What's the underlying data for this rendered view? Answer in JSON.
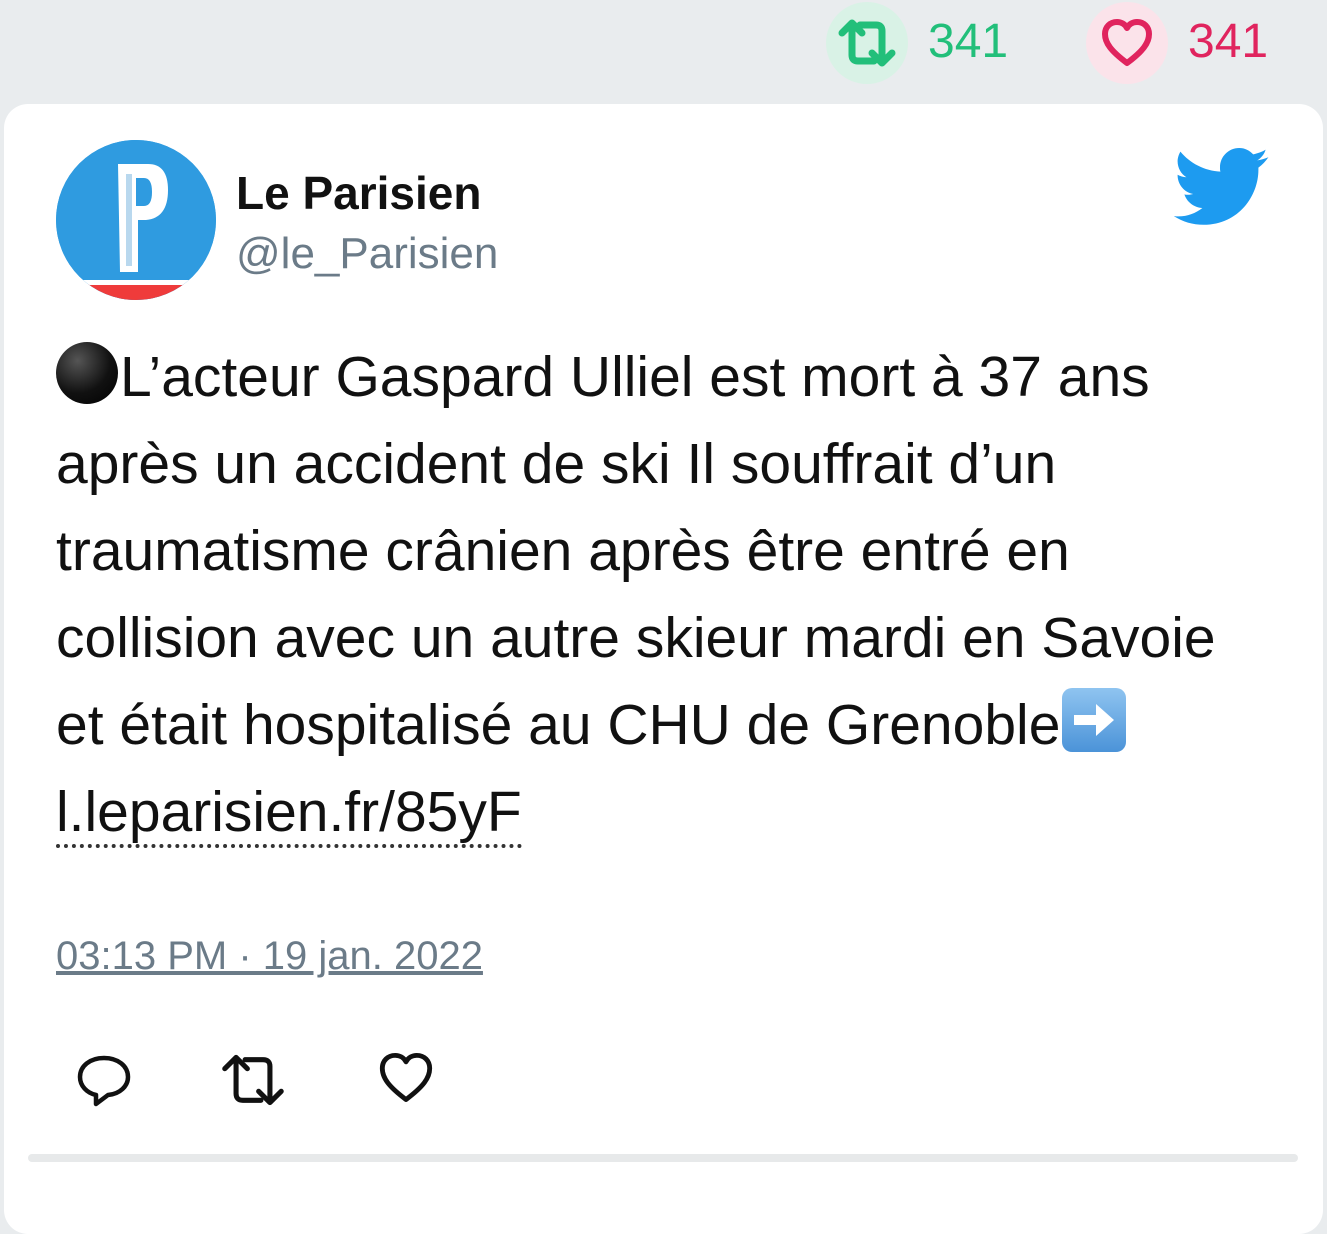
{
  "stats": {
    "retweet_count": "341",
    "like_count": "341",
    "retweet_icon": "retweet-icon",
    "like_icon": "heart-icon"
  },
  "author": {
    "name": "Le Parisien",
    "handle": "@le_Parisien",
    "avatar_letter": "P"
  },
  "tweet": {
    "text_before_link": "L’acteur Gaspard Ulliel est mort à 37 ans après un accident de ski Il souffrait d’un traumatisme crânien après être entré en collision avec un autre skieur mardi en Savoie et était hospitalisé au CHU de Grenoble",
    "link_text": "l.leparisien.fr/85yF",
    "leading_emoji": "black-circle-emoji",
    "arrow_emoji": "right-arrow-emoji"
  },
  "timestamp": "03:13 PM · 19 jan. 2022",
  "actions": [
    "reply-icon",
    "retweet-icon",
    "like-icon"
  ],
  "colors": {
    "retweet": "#22bf7a",
    "like": "#e0245e",
    "twitter_blue": "#1d9bf0",
    "muted": "#6b7b88"
  }
}
